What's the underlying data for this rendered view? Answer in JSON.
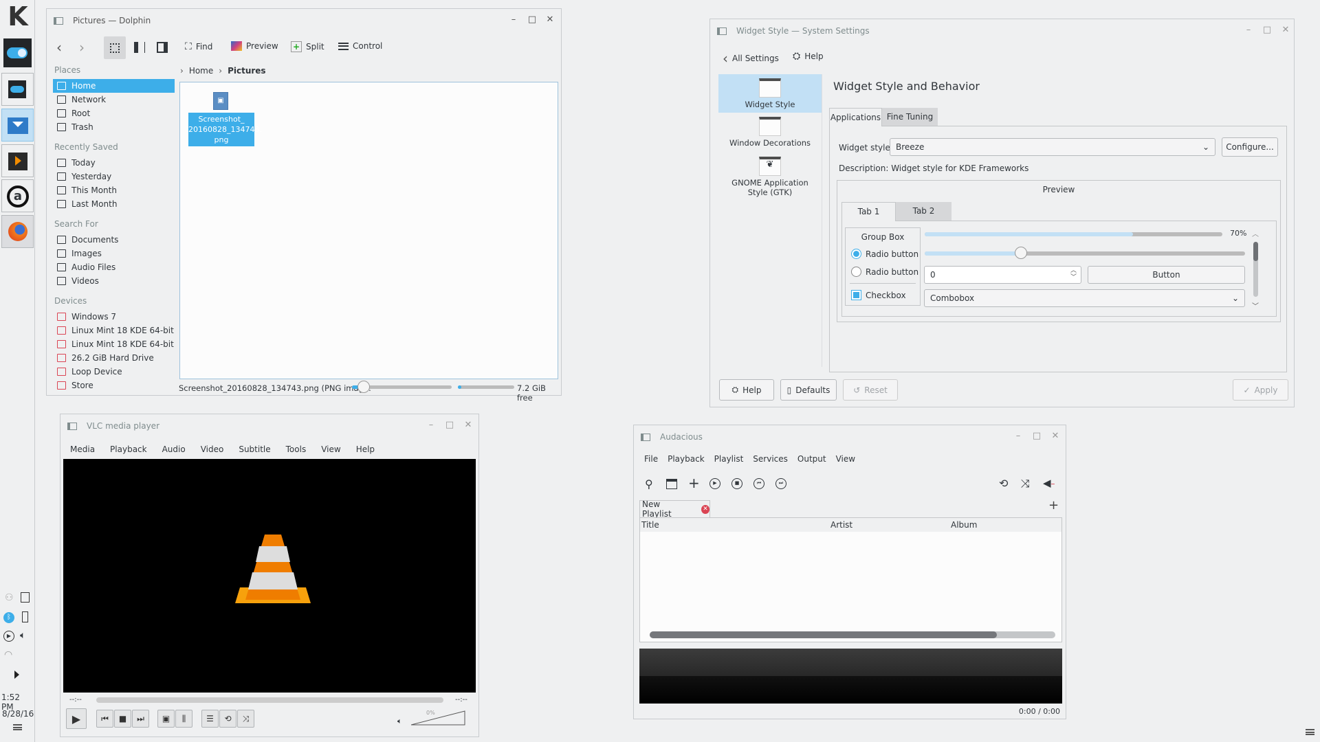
{
  "panel": {
    "clock_time": "1:52 PM",
    "clock_date": "8/28/16",
    "launchers": [
      "kde-menu-icon",
      "system-settings-icon",
      "system-settings-icon",
      "dolphin-icon",
      "vlc-icon",
      "audacious-icon",
      "firefox-icon"
    ]
  },
  "dolphin": {
    "title": "Pictures — Dolphin",
    "toolbar": {
      "find": "Find",
      "preview": "Preview",
      "split": "Split",
      "control": "Control"
    },
    "breadcrumb": [
      "Home",
      "Pictures"
    ],
    "sections": [
      {
        "label": "Places",
        "items": [
          "Home",
          "Network",
          "Root",
          "Trash"
        ]
      },
      {
        "label": "Recently Saved",
        "items": [
          "Today",
          "Yesterday",
          "This Month",
          "Last Month"
        ]
      },
      {
        "label": "Search For",
        "items": [
          "Documents",
          "Images",
          "Audio Files",
          "Videos"
        ]
      },
      {
        "label": "Devices",
        "items": [
          "Windows 7",
          "Linux Mint 18 KDE 64-bit",
          "Linux Mint 18 KDE 64-bit",
          "26.2 GiB Hard Drive",
          "Loop Device",
          "Store"
        ]
      }
    ],
    "selected_place": "Home",
    "file": {
      "line1": "Screenshot_",
      "line2": "20160828_134743.",
      "line3": "png"
    },
    "status": "Screenshot_20160828_134743.png (PNG imag...",
    "zoom_percent": 12,
    "space_used_percent": 3,
    "free": "7.2 GiB free"
  },
  "settings": {
    "title": "Widget Style  — System Settings",
    "all_settings": "All Settings",
    "help": "Help",
    "categories": [
      "Widget Style",
      "Window Decorations",
      "GNOME Application",
      "Style (GTK)"
    ],
    "heading": "Widget Style and Behavior",
    "tabs": [
      "Applications",
      "Fine Tuning"
    ],
    "widget_style_label": "Widget style:",
    "widget_style_value": "Breeze",
    "configure": "Configure...",
    "description": "Description: Widget style for KDE Frameworks",
    "preview": {
      "label": "Preview",
      "tabs": [
        "Tab 1",
        "Tab 2"
      ],
      "group_box": "Group Box",
      "radio1": "Radio button",
      "radio2": "Radio button",
      "checkbox": "Checkbox",
      "progress": 70,
      "progress_label": "70%",
      "slider_percent": 30,
      "spin_value": "0",
      "button": "Button",
      "combobox": "Combobox"
    },
    "buttons": {
      "help": "Help",
      "defaults": "Defaults",
      "reset": "Reset",
      "apply": "Apply"
    }
  },
  "vlc": {
    "title": "VLC media player",
    "menu": [
      "Media",
      "Playback",
      "Audio",
      "Video",
      "Subtitle",
      "Tools",
      "View",
      "Help"
    ],
    "time_left": "--:--",
    "time_right": "--:--",
    "volume": "0%"
  },
  "audacious": {
    "title": "Audacious",
    "menu": [
      "File",
      "Playback",
      "Playlist",
      "Services",
      "Output",
      "View"
    ],
    "playlist_tab": "New Playlist",
    "columns": [
      "Title",
      "Artist",
      "Album"
    ],
    "time": "0:00 / 0:00"
  },
  "colors": {
    "accent": "#3daee9",
    "selection_light": "#c2e0f5",
    "vlc_orange": "#f28c00"
  }
}
